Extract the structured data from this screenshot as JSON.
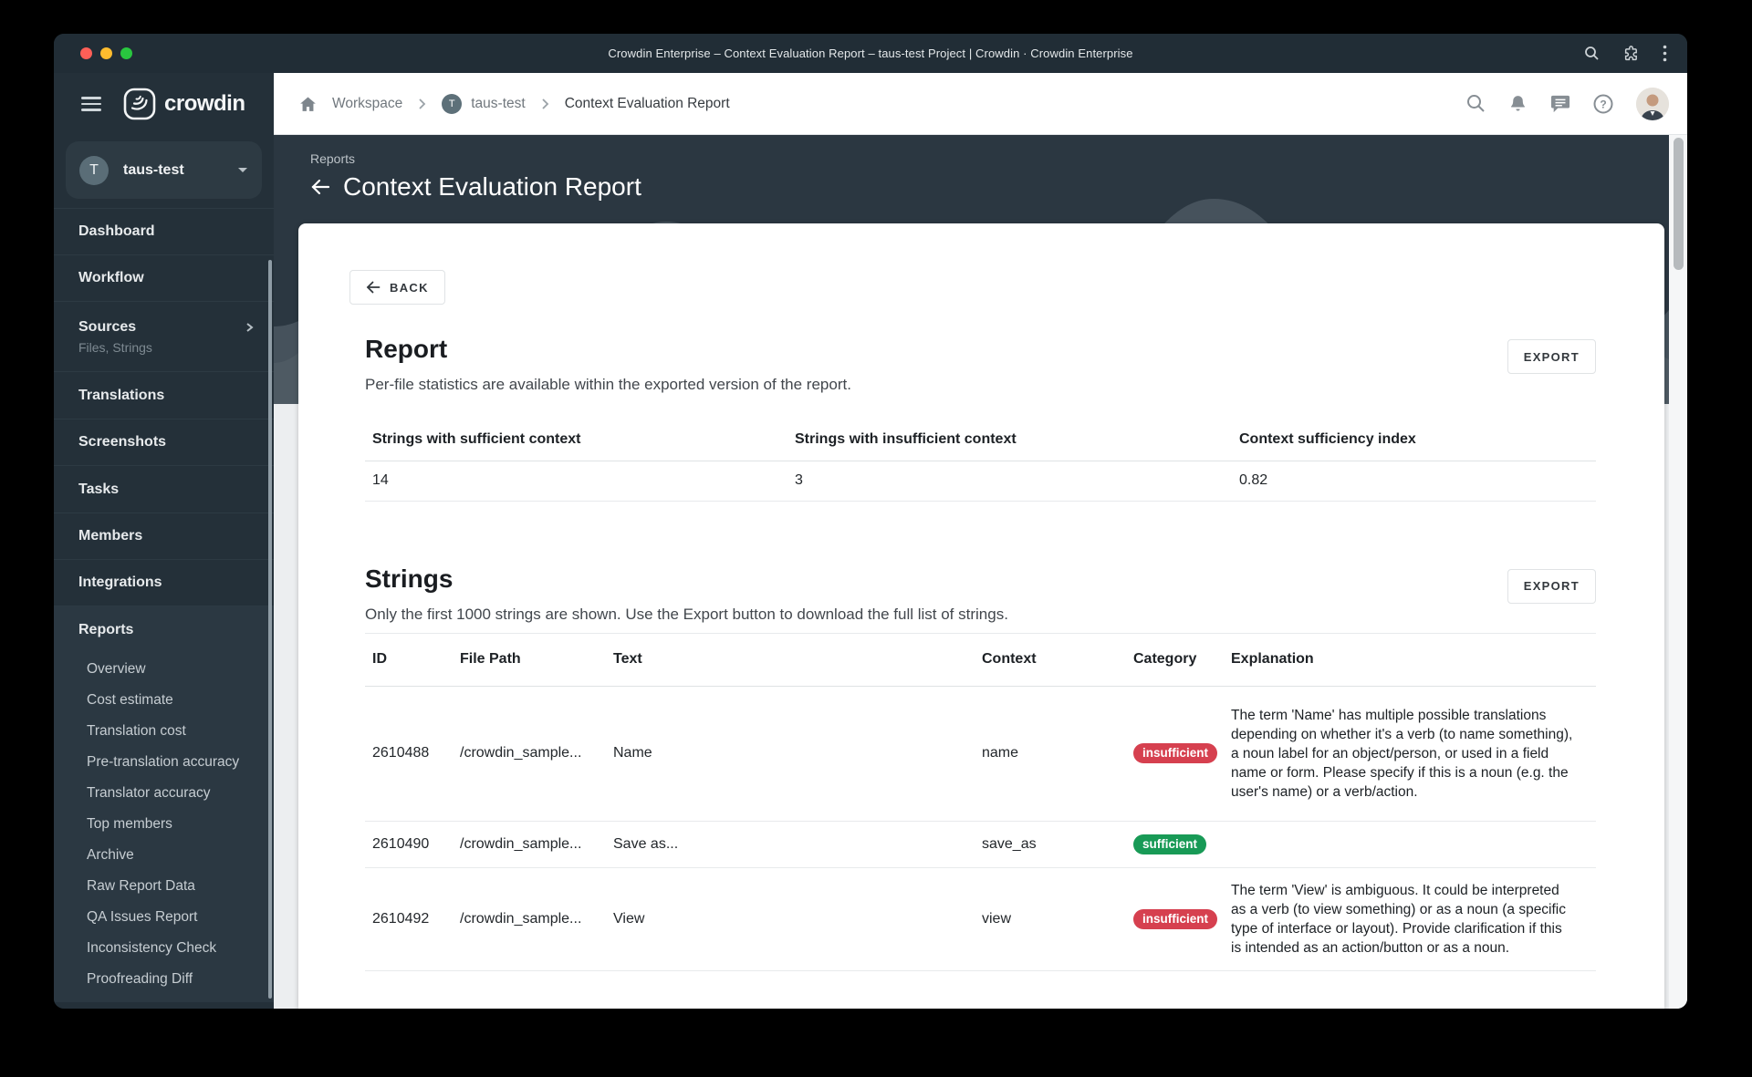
{
  "titlebar": {
    "title": "Crowdin Enterprise – Context Evaluation Report – taus-test Project | Crowdin · Crowdin Enterprise"
  },
  "sidebar": {
    "logo_text": "crowdin",
    "team": {
      "initial": "T",
      "name": "taus-test"
    },
    "items": [
      "Dashboard",
      "Workflow",
      "Sources",
      "Translations",
      "Screenshots",
      "Tasks",
      "Members",
      "Integrations"
    ],
    "sources_subtitle": "Files, Strings",
    "reports_label": "Reports",
    "reports_subitems": [
      "Overview",
      "Cost estimate",
      "Translation cost",
      "Pre-translation accuracy",
      "Translator accuracy",
      "Top members",
      "Archive",
      "Raw Report Data",
      "QA Issues Report",
      "Inconsistency Check",
      "Proofreading Diff"
    ]
  },
  "breadcrumb": {
    "workspace": "Workspace",
    "project_initial": "T",
    "project": "taus-test",
    "current": "Context Evaluation Report"
  },
  "hero": {
    "eyebrow": "Reports",
    "title": "Context Evaluation Report"
  },
  "report": {
    "back_label": "BACK",
    "title": "Report",
    "subtitle": "Per-file statistics are available within the exported version of the report.",
    "export_label": "EXPORT",
    "stats": {
      "headers": [
        "Strings with sufficient context",
        "Strings with insufficient context",
        "Context sufficiency index"
      ],
      "values": [
        "14",
        "3",
        "0.82"
      ]
    }
  },
  "strings": {
    "title": "Strings",
    "subtitle": "Only the first 1000 strings are shown. Use the Export button to download the full list of strings.",
    "export_label": "EXPORT",
    "columns": [
      "ID",
      "File Path",
      "Text",
      "Context",
      "Category",
      "Explanation"
    ],
    "rows": [
      {
        "id": "2610488",
        "file_path": "/crowdin_sample...",
        "text": "Name",
        "context": "name",
        "category": "insufficient",
        "explanation": "The term 'Name' has multiple possible translations depending on whether it's a verb (to name something), a noun label for an object/person, or used in a field name or form. Please specify if this is a noun (e.g. the user's name) or a verb/action."
      },
      {
        "id": "2610490",
        "file_path": "/crowdin_sample...",
        "text": "Save as...",
        "context": "save_as",
        "category": "sufficient",
        "explanation": ""
      },
      {
        "id": "2610492",
        "file_path": "/crowdin_sample...",
        "text": "View",
        "context": "view",
        "category": "insufficient",
        "explanation": "The term 'View' is ambiguous. It could be interpreted as a verb (to view something) or as a noun (a specific type of interface or layout). Provide clarification if this is intended as an action/button or as a noun."
      }
    ]
  },
  "colors": {
    "badge_insufficient": "#d6404f",
    "badge_sufficient": "#189a56",
    "sidebar_bg": "#243039",
    "titlebar_bg": "#212d36",
    "hero_bg": "#2b3741"
  }
}
